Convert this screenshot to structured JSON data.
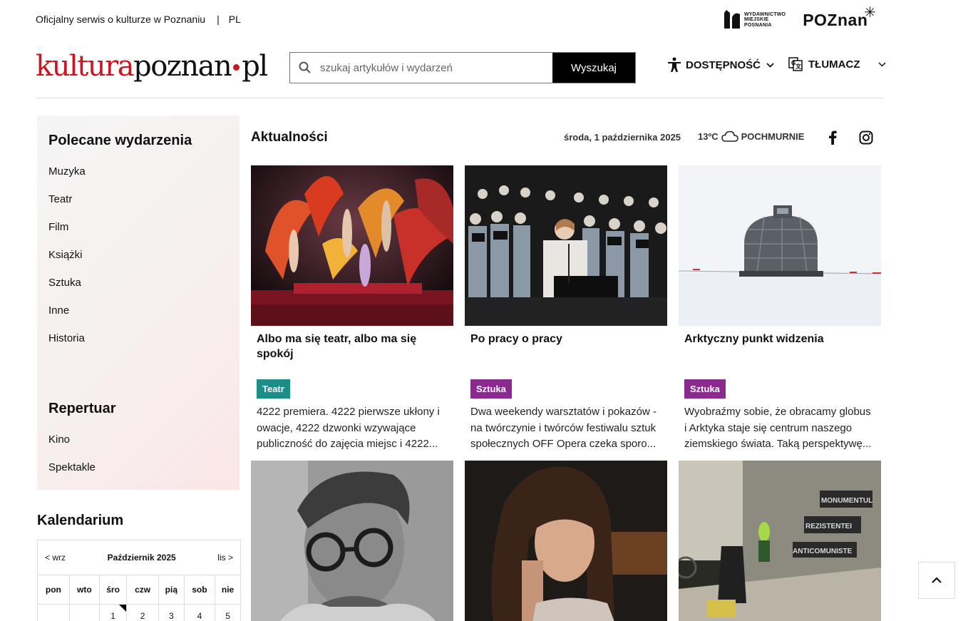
{
  "topbar": {
    "service_text": "Oficjalny serwis o kulturze w Poznaniu",
    "separator": "|",
    "lang": "PL",
    "wm_logo_line1": "WYDAWNICTWO",
    "wm_logo_line2": "MIEJSKIE",
    "wm_logo_line3": "POSNANIA",
    "poznan_logo": "POZnan"
  },
  "header": {
    "logo_kultura": "kultura",
    "logo_poznan": "poznan",
    "logo_pl": "pl",
    "search_placeholder": "szukaj artykułów i wydarzeń",
    "search_button": "Wyszukaj",
    "accessibility": "DOSTĘPNOŚĆ",
    "translate": "TŁUMACZ"
  },
  "sidebar": {
    "featured_title": "Polecane wydarzenia",
    "featured_items": [
      "Muzyka",
      "Teatr",
      "Film",
      "Książki",
      "Sztuka",
      "Inne",
      "Historia"
    ],
    "repertoire_title": "Repertuar",
    "repertoire_items": [
      "Kino",
      "Spektakle"
    ]
  },
  "calendar": {
    "title": "Kalendarium",
    "prev": "< wrz",
    "month": "Październik 2025",
    "next": "lis >",
    "weekdays": [
      "pon",
      "wto",
      "śro",
      "czw",
      "pią",
      "sob",
      "nie"
    ],
    "first_row": [
      "",
      "",
      "1",
      "2",
      "3",
      "4",
      "5"
    ]
  },
  "main": {
    "title": "Aktualności",
    "date": "środa, 1 października 2025",
    "temperature": "13ºC",
    "weather": "POCHMURNIE",
    "cards": [
      {
        "title": "Albo ma się teatr, albo ma się spokój",
        "category": "Teatr",
        "excerpt": "4222 premiera. 4222 pierwsze ukłony i owacje, 4222 dzwonki wzywające publiczność do zajęcia miejsc i 4222..."
      },
      {
        "title": "Po pracy o pracy",
        "category": "Sztuka",
        "excerpt": "Dwa weekendy warsztatów i pokazów - na twórczynie i twórców festiwalu sztuk społecznych OFF Opera czeka sporo..."
      },
      {
        "title": "Arktyczny punkt widzenia",
        "category": "Sztuka",
        "excerpt": "Wyobraźmy sobie, że obracamy globus i Arktyka staje się centrum naszego ziemskiego świata. Taką perspektywę..."
      }
    ],
    "second_row_sign_texts": [
      "MONUMENTUL",
      "REZISTENTEI",
      "ANTICOMUNISTE"
    ]
  },
  "colors": {
    "brand_red": "#d1121f",
    "teatr_badge": "#1d8d87",
    "sztuka_badge": "#8b2a8e"
  }
}
